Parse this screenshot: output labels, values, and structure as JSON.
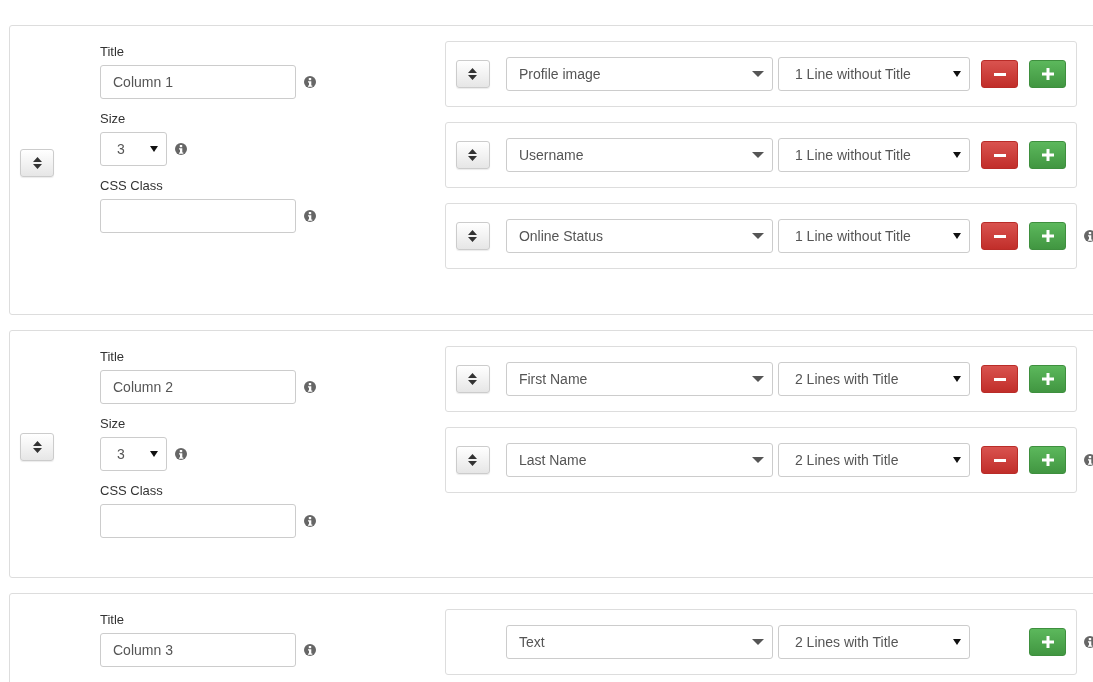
{
  "columns": [
    {
      "sort_handle": true,
      "fields": [
        {
          "kind": "text",
          "label": "Title",
          "value": "Column 1"
        },
        {
          "kind": "select",
          "label": "Size",
          "value": "3"
        },
        {
          "kind": "text",
          "label": "CSS Class"
        }
      ],
      "rows": [
        {
          "sort_handle": true,
          "field": "Profile image",
          "display": "1 Line without Title",
          "removable": true,
          "info": false
        },
        {
          "sort_handle": true,
          "field": "Username",
          "display": "1 Line without Title",
          "removable": true,
          "info": false
        },
        {
          "sort_handle": true,
          "field": "Online Status",
          "display": "1 Line without Title",
          "removable": true,
          "info": true
        }
      ]
    },
    {
      "sort_handle": true,
      "fields": [
        {
          "kind": "text",
          "label": "Title",
          "value": "Column 2"
        },
        {
          "kind": "select",
          "label": "Size",
          "value": "3"
        },
        {
          "kind": "text",
          "label": "CSS Class"
        }
      ],
      "rows": [
        {
          "sort_handle": true,
          "field": "First Name",
          "display": "2 Lines with Title",
          "removable": true,
          "info": false
        },
        {
          "sort_handle": true,
          "field": "Last Name",
          "display": "2 Lines with Title",
          "removable": true,
          "info": true
        }
      ]
    },
    {
      "sort_handle": false,
      "fields": [
        {
          "kind": "text",
          "label": "Title",
          "value": "Column 3"
        }
      ],
      "rows": [
        {
          "sort_handle": false,
          "field": "Text",
          "display": "2 Lines with Title",
          "removable": false,
          "info": true
        }
      ]
    }
  ]
}
